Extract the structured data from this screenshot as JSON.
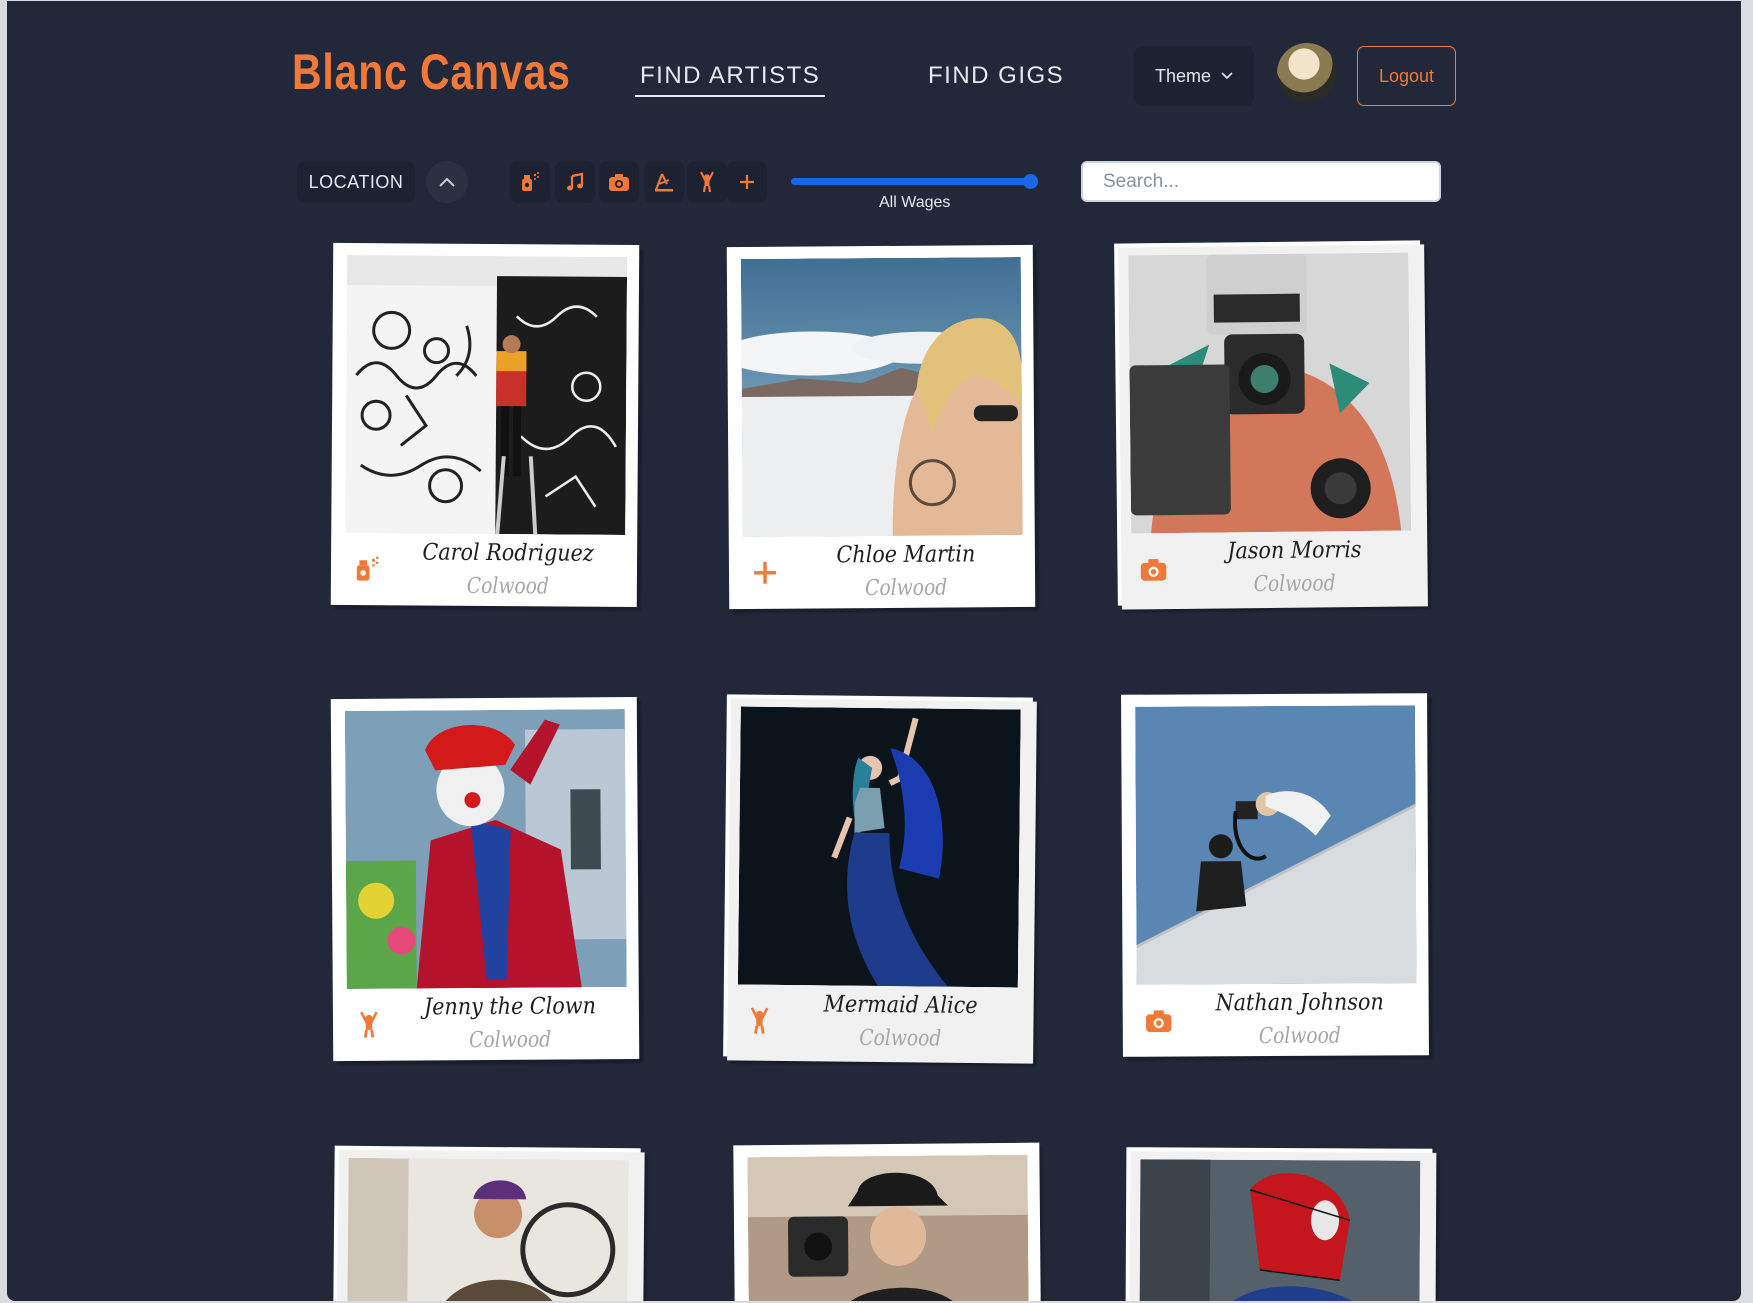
{
  "header": {
    "brand": "Blanc Canvas",
    "nav": {
      "find_artists": "FIND ARTISTS",
      "find_gigs": "FIND GIGS"
    },
    "theme_label": "Theme",
    "logout_label": "Logout"
  },
  "filters": {
    "location_label": "LOCATION",
    "categories": [
      "spray-paint-icon",
      "music-note-icon",
      "camera-icon",
      "sculpture-icon",
      "performer-icon",
      "plus-icon"
    ],
    "wage_label": "All Wages",
    "search_placeholder": "Search..."
  },
  "colors": {
    "accent": "#f0793a",
    "background": "#222839",
    "slider": "#1967e6"
  },
  "artists": [
    {
      "name": "Carol Rodriguez",
      "location": "Colwood",
      "icon": "spray-paint-icon"
    },
    {
      "name": "Chloe Martin",
      "location": "Colwood",
      "icon": "plus-icon"
    },
    {
      "name": "Jason Morris",
      "location": "Colwood",
      "icon": "camera-icon"
    },
    {
      "name": "Jenny the Clown",
      "location": "Colwood",
      "icon": "performer-icon"
    },
    {
      "name": "Mermaid Alice",
      "location": "Colwood",
      "icon": "performer-icon"
    },
    {
      "name": "Nathan Johnson",
      "location": "Colwood",
      "icon": "camera-icon"
    }
  ]
}
